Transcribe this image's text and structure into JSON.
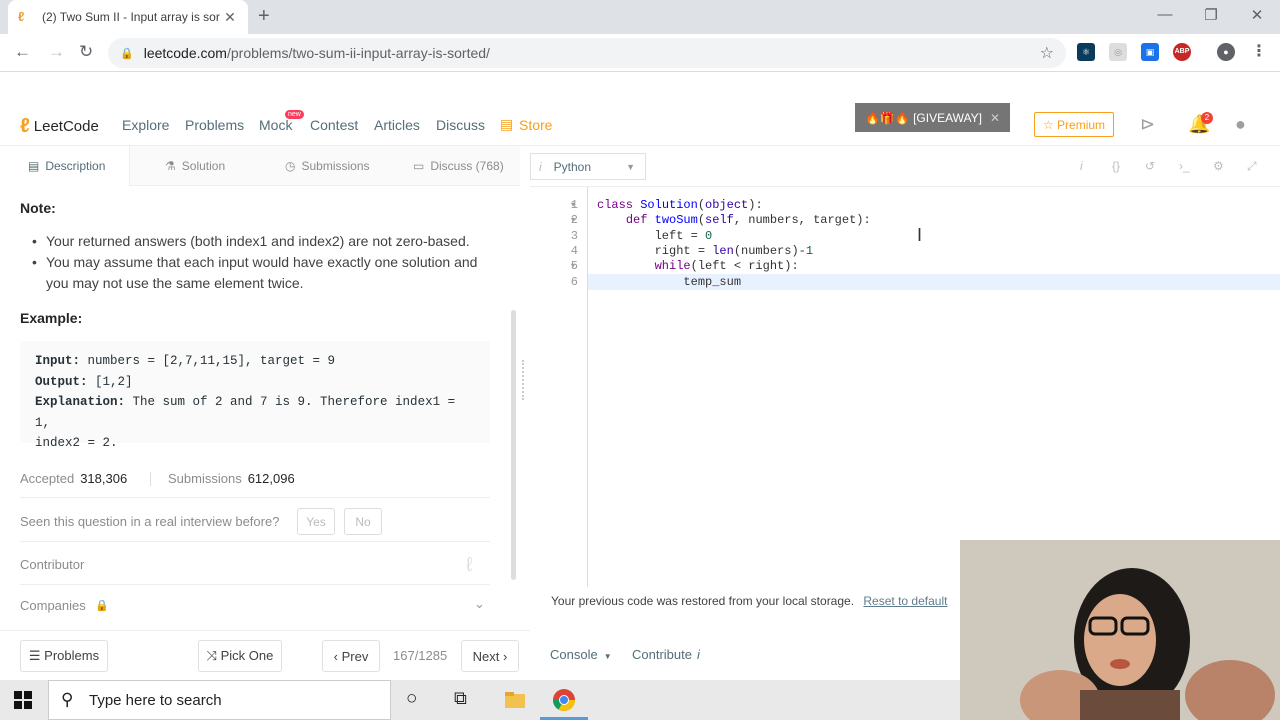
{
  "browser": {
    "tab_title": "(2) Two Sum II - Input array is sor",
    "tab_close": "✕",
    "new_tab": "+",
    "url_domain": "leetcode.com",
    "url_path": "/problems/two-sum-ii-input-array-is-sorted/"
  },
  "nav": {
    "logo_text": "LeetCode",
    "links": [
      "Explore",
      "Problems",
      "Mock",
      "Contest",
      "Articles",
      "Discuss",
      "Store"
    ],
    "mock_badge": "new",
    "giveaway": "🔥🎁🔥 [GIVEAWAY]",
    "giveaway_close": "✕",
    "premium": "☆ Premium",
    "notif_count": "2"
  },
  "problem_tabs": [
    "Description",
    "Solution",
    "Submissions",
    "Discuss (768)"
  ],
  "description": {
    "note_heading": "Note:",
    "bullets": [
      "Your returned answers (both index1 and index2) are not zero-based.",
      "You may assume that each input would have exactly one solution and you may not use the same element twice."
    ],
    "example_heading": "Example:",
    "example": {
      "input_label": "Input:",
      "input_value": " numbers = [2,7,11,15], target = 9",
      "output_label": "Output:",
      "output_value": " [1,2]",
      "explanation_label": "Explanation:",
      "explanation_value_1": " The sum of 2 and 7 is 9. Therefore index1 = 1,",
      "explanation_value_2": "index2 = 2."
    },
    "accepted_label": "Accepted",
    "accepted_value": "318,306",
    "submissions_label": "Submissions",
    "submissions_value": "612,096",
    "interview_question": "Seen this question in a real interview before?",
    "yes": "Yes",
    "no": "No",
    "contributor": "Contributor",
    "companies": "Companies"
  },
  "bottom": {
    "problems": "☰ Problems",
    "pick_one": "⤨ Pick One",
    "prev": "‹  Prev",
    "counter": "167/1285",
    "next": "Next  ›",
    "console": "Console",
    "contribute": "Contribute"
  },
  "editor": {
    "language": "Python",
    "line_numbers": [
      "1",
      "2",
      "3",
      "4",
      "5",
      "6"
    ],
    "restore_notice": "Your previous code was restored from your local storage.",
    "reset_link": "Reset to default"
  },
  "taskbar": {
    "search_placeholder": "Type here to search"
  },
  "colors": {
    "brand_orange": "#f89f1b",
    "giveaway_bg": "#757575",
    "chrome_tabstrip": "#dee1e6"
  }
}
